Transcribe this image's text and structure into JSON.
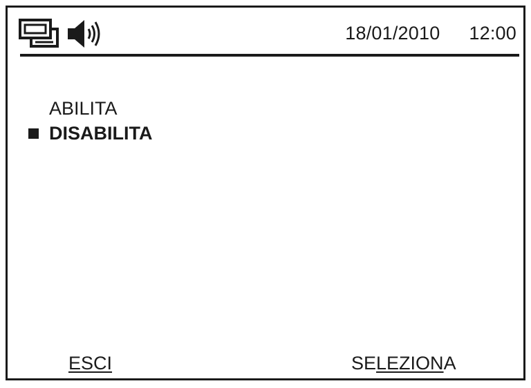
{
  "status_bar": {
    "icons": [
      "network-icon",
      "speaker-icon"
    ],
    "date": "18/01/2010",
    "time": "12:00"
  },
  "menu": {
    "items": [
      {
        "label": "ABILITA",
        "selected": false
      },
      {
        "label": "DISABILITA",
        "selected": true
      }
    ]
  },
  "softkeys": {
    "left": "ESCI",
    "right_prefix": "SE",
    "right_underlined": "LEZION",
    "right_suffix": "A"
  },
  "colors": {
    "foreground": "#1a1a1a",
    "background": "#ffffff"
  }
}
